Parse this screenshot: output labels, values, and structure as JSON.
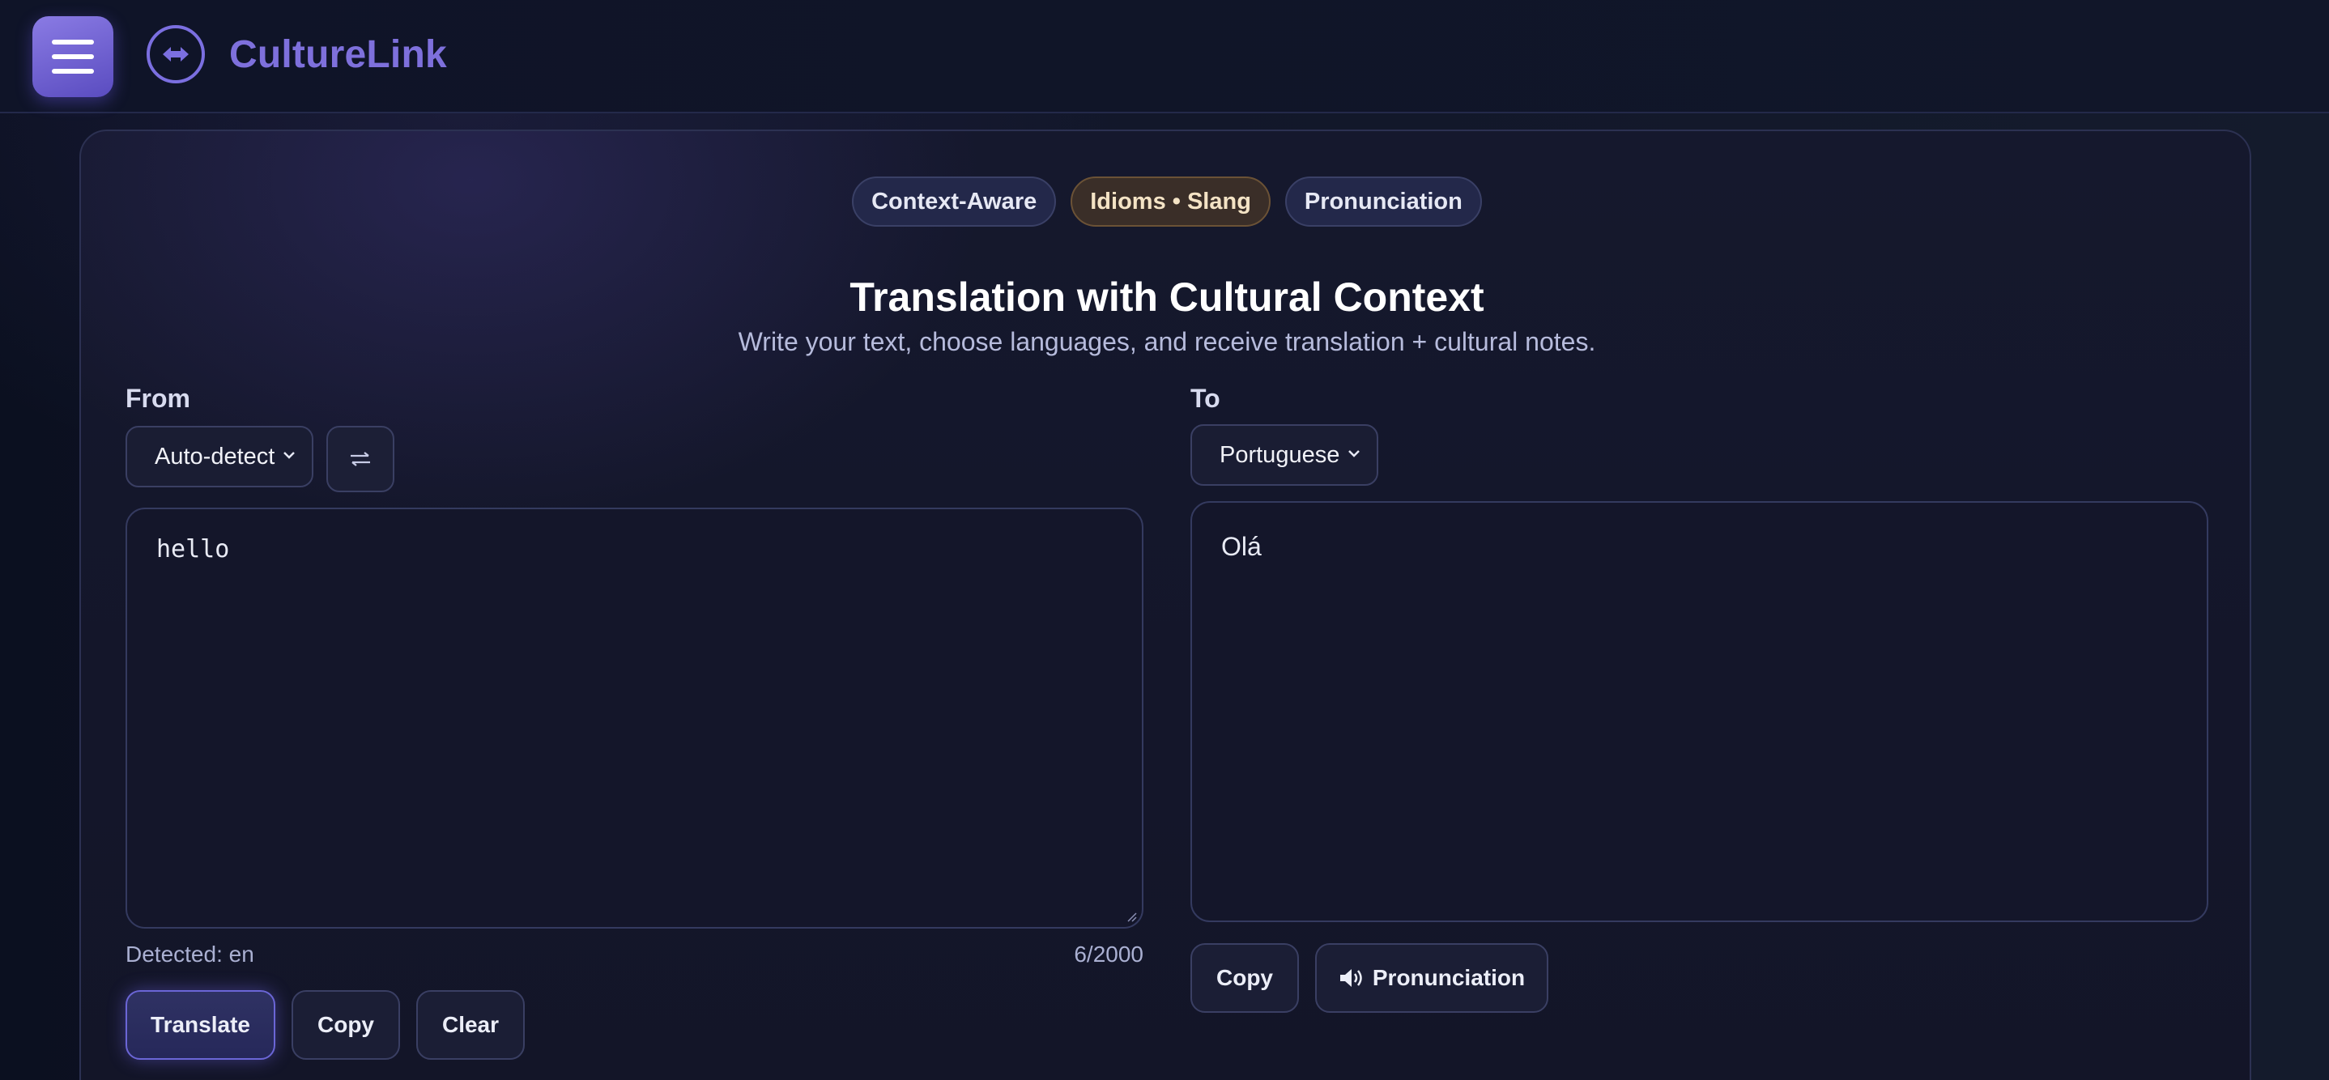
{
  "app": {
    "brand": "CultureLink"
  },
  "header": {
    "menu_icon": "hamburger-icon",
    "logo_icon": "swap-arrows-icon"
  },
  "features": [
    {
      "label": "Context-Aware"
    },
    {
      "label": "Idioms • Slang"
    },
    {
      "label": "Pronunciation"
    }
  ],
  "hero": {
    "title": "Translation with Cultural Context",
    "subtitle": "Write your text, choose languages, and receive translation + cultural notes."
  },
  "source": {
    "label": "From",
    "language": "Auto-detect",
    "swap_icon": "swap-icon",
    "text": "hello",
    "detected": "Detected: en",
    "count": "6/2000"
  },
  "target": {
    "label": "To",
    "language": "Portuguese",
    "text": "Olá"
  },
  "actions": {
    "translate": "Translate",
    "copy": "Copy",
    "clear": "Clear",
    "copy_output": "Copy",
    "pronunciation": "Pronunciation"
  },
  "colors": {
    "accent": "#7e70dc",
    "background": "#0e1223",
    "card": "#14162a"
  }
}
